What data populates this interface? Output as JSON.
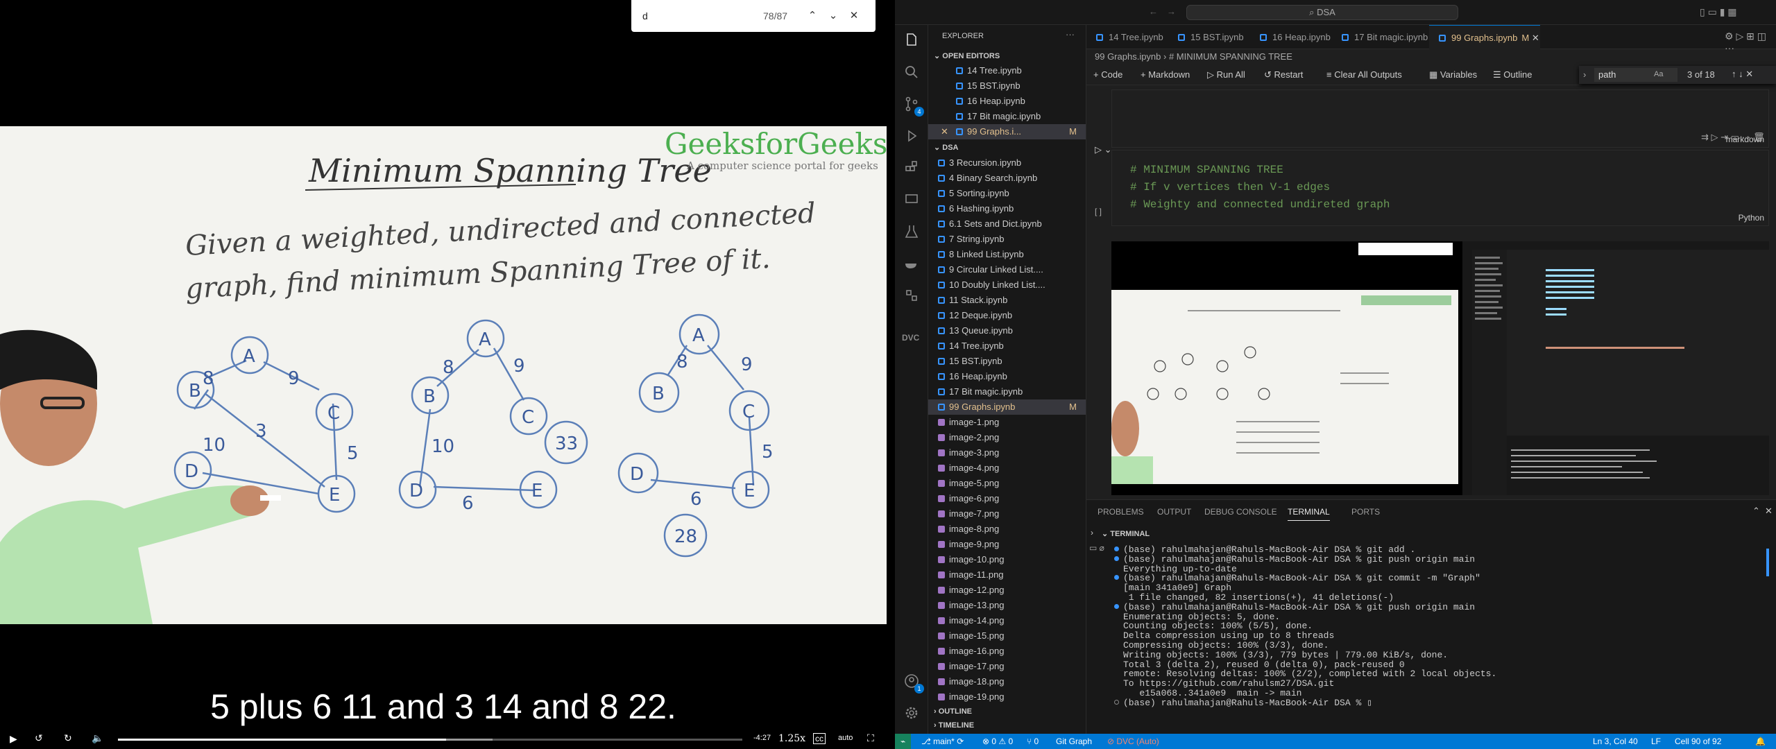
{
  "video": {
    "find": {
      "query": "d",
      "count": "78/87"
    },
    "board": {
      "brand": "GeeksforGeeks",
      "brand_tag": "A computer science portal for geeks",
      "title": "Minimum Spanning Tree",
      "line1": "Given a weighted, undirected and connected",
      "line2": "graph, find minimum Spanning Tree of it.",
      "g1": {
        "nodes": [
          "A",
          "B",
          "C",
          "D",
          "E"
        ],
        "weights": [
          "8",
          "9",
          "3",
          "10",
          "5"
        ]
      },
      "g2": {
        "nodes": [
          "A",
          "B",
          "C",
          "D",
          "E"
        ],
        "weights": [
          "8",
          "9",
          "10",
          "6",
          "33"
        ]
      },
      "g3": {
        "nodes": [
          "A",
          "B",
          "C",
          "D",
          "E"
        ],
        "weights": [
          "8",
          "9",
          "5",
          "6",
          "28"
        ]
      }
    },
    "caption": "5 plus 6 11 and 3 14 and 8 22.",
    "controls": {
      "time": "-4:27",
      "speed": "1.25x",
      "quality": "auto",
      "progress": 0.525,
      "buffered": 0.6
    }
  },
  "vscode": {
    "search": "DSA",
    "explorer_title": "EXPLORER",
    "open_editors_label": "OPEN EDITORS",
    "open_editors": [
      "14 Tree.ipynb",
      "15 BST.ipynb",
      "16 Heap.ipynb",
      "17 Bit magic.ipynb",
      "99 Graphs.i..."
    ],
    "open_editors_mod": "M",
    "folder": "DSA",
    "files": [
      "3 Recursion.ipynb",
      "4 Binary Search.ipynb",
      "5 Sorting.ipynb",
      "6 Hashing.ipynb",
      "6.1 Sets and Dict.ipynb",
      "7 String.ipynb",
      "8 Linked List.ipynb",
      "9 Circular Linked List....",
      "10 Doubly Linked List....",
      "11 Stack.ipynb",
      "12 Deque.ipynb",
      "13 Queue.ipynb",
      "14 Tree.ipynb",
      "15 BST.ipynb",
      "16 Heap.ipynb",
      "17 Bit magic.ipynb",
      "99 Graphs.ipynb",
      "image-1.png",
      "image-2.png",
      "image-3.png",
      "image-4.png",
      "image-5.png",
      "image-6.png",
      "image-7.png",
      "image-8.png",
      "image-9.png",
      "image-10.png",
      "image-11.png",
      "image-12.png",
      "image-13.png",
      "image-14.png",
      "image-15.png",
      "image-16.png",
      "image-17.png",
      "image-18.png",
      "image-19.png"
    ],
    "selected_file": "99 Graphs.ipynb",
    "outline_label": "OUTLINE",
    "timeline_label": "TIMELINE",
    "tabs": [
      "14 Tree.ipynb",
      "15 BST.ipynb",
      "16 Heap.ipynb",
      "17 Bit magic.ipynb",
      "99 Graphs.ipynb"
    ],
    "active_tab_mod": "M",
    "breadcrumb": {
      "file": "99 Graphs.ipynb",
      "section": "# MINIMUM SPANNING TREE"
    },
    "toolbar": {
      "code": "Code",
      "markdown": "Markdown",
      "run_all": "Run All",
      "restart": "Restart",
      "clear": "Clear All Outputs",
      "variables": "Variables",
      "outline": "Outline"
    },
    "find": {
      "query": "path",
      "aa": "Aa",
      "result": "3 of 18"
    },
    "cell_lang_md": "markdown",
    "code_lines": [
      "# MINIMUM SPANNING TREE",
      "# If v vertices then  V-1 edges",
      "# Weighty and connected undireted graph"
    ],
    "cell_exec": "[ ]",
    "cell_lang": "Python",
    "panel_tabs": [
      "PROBLEMS",
      "OUTPUT",
      "DEBUG CONSOLE",
      "TERMINAL",
      "PORTS"
    ],
    "terminal_label": "TERMINAL",
    "terminal": [
      "(base) rahulmahajan@Rahuls-MacBook-Air DSA % git add .",
      "(base) rahulmahajan@Rahuls-MacBook-Air DSA % git push origin main",
      "Everything up-to-date",
      "(base) rahulmahajan@Rahuls-MacBook-Air DSA % git commit -m \"Graph\"",
      "[main 341a0e9] Graph",
      " 1 file changed, 82 insertions(+), 41 deletions(-)",
      "(base) rahulmahajan@Rahuls-MacBook-Air DSA % git push origin main",
      "Enumerating objects: 5, done.",
      "Counting objects: 100% (5/5), done.",
      "Delta compression using up to 8 threads",
      "Compressing objects: 100% (3/3), done.",
      "Writing objects: 100% (3/3), 779 bytes | 779.00 KiB/s, done.",
      "Total 3 (delta 2), reused 0 (delta 0), pack-reused 0",
      "remote: Resolving deltas: 100% (2/2), completed with 2 local objects.",
      "To https://github.com/rahulsm27/DSA.git",
      "   e15a068..341a0e9  main -> main",
      "(base) rahulmahajan@Rahuls-MacBook-Air DSA % "
    ],
    "status": {
      "branch": "main*",
      "errors": "0",
      "warnings": "0",
      "ports": "0",
      "git_graph": "Git Graph",
      "dvc": "DVC (Auto)",
      "position": "Ln 3, Col 40",
      "eol": "LF",
      "cell": "Cell 90 of 92"
    },
    "badges": {
      "scm": "4",
      "account": "1"
    }
  }
}
